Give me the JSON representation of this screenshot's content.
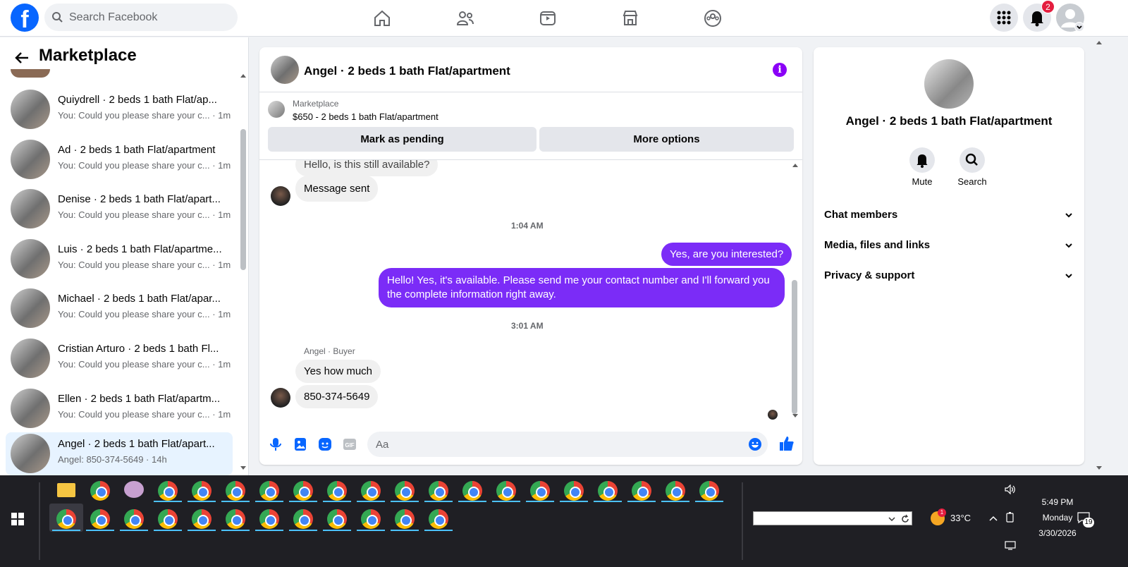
{
  "topbar": {
    "search_placeholder": "Search Facebook",
    "notification_count": "2"
  },
  "left": {
    "title": "Marketplace",
    "conversations": [
      {
        "name": "Quiydrell · 2 beds 1 bath Flat/ap...",
        "snippet": "You: Could you please share your c... · 1m"
      },
      {
        "name": "Ad · 2 beds 1 bath Flat/apartment",
        "snippet": "You: Could you please share your c... · 1m"
      },
      {
        "name": "Denise · 2 beds 1 bath Flat/apart...",
        "snippet": "You: Could you please share your c... · 1m"
      },
      {
        "name": "Luis · 2 beds 1 bath Flat/apartme...",
        "snippet": "You: Could you please share your c... · 1m"
      },
      {
        "name": "Michael · 2 beds 1 bath Flat/apar...",
        "snippet": "You: Could you please share your c... · 1m"
      },
      {
        "name": "Cristian Arturo · 2 beds 1 bath Fl...",
        "snippet": "You: Could you please share your c... · 1m"
      },
      {
        "name": "Ellen · 2 beds 1 bath Flat/apartm...",
        "snippet": "You: Could you please share your c... · 1m"
      },
      {
        "name": "Angel · 2 beds 1 bath Flat/apart...",
        "snippet": "Angel: 850-374-5649 · 14h"
      }
    ]
  },
  "chat": {
    "title": "Angel · 2 beds 1 bath Flat/apartment",
    "listing_source": "Marketplace",
    "listing_title": "$650 - 2 beds 1 bath Flat/apartment",
    "mark_pending": "Mark as pending",
    "more_options": "More options",
    "messages": {
      "partial_top": "Hello, is this still available?",
      "sent_auto": "Message sent",
      "time1": "1:04 AM",
      "out1": "Yes, are you interested?",
      "out2": "Hello! Yes, it's available. Please send me your contact number and I'll forward you the complete information right away.",
      "time2": "3:01 AM",
      "sender_label": "Angel · Buyer",
      "in1": "Yes how much",
      "in2": "850-374-5649"
    },
    "composer_placeholder": "Aa"
  },
  "right": {
    "name": "Angel · 2 beds 1 bath Flat/apartment",
    "mute": "Mute",
    "search": "Search",
    "sections": [
      "Chat members",
      "Media, files and links",
      "Privacy & support"
    ]
  },
  "taskbar": {
    "temperature": "33°C",
    "time": "5:49 PM",
    "day": "Monday",
    "date": "3/30/2026",
    "notif_count": "19",
    "weather_badge": "1"
  },
  "colors": {
    "accent": "#7b2cf7",
    "brand": "#0866ff"
  }
}
